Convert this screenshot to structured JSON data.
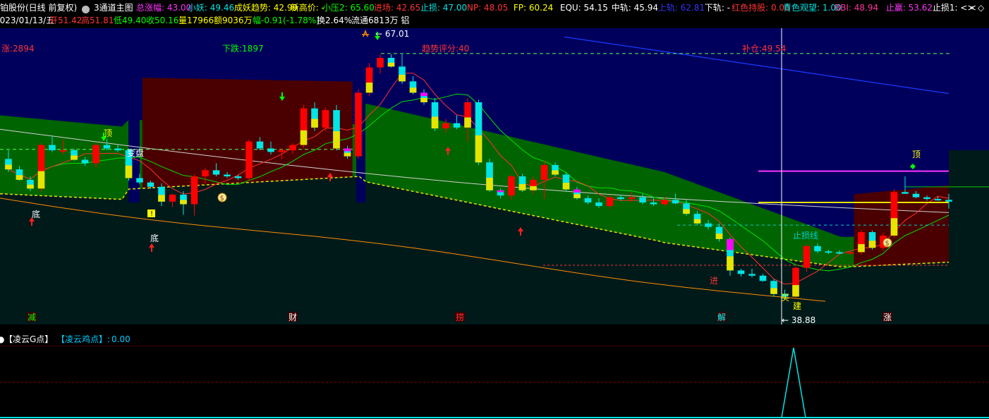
{
  "header": {
    "stock_name": "铂股份(日线 前复权)",
    "indicator": "3通道主图",
    "items": [
      {
        "label": "总涨幅:",
        "value": "43.00",
        "color": "#ff33ff"
      },
      {
        "label": "小妖:",
        "value": "49.46",
        "color": "#00e5e5"
      },
      {
        "label": "成妖趋势:",
        "value": "42.99",
        "color": "#ffff00"
      },
      {
        "label": "新高价:",
        "value": "-",
        "color": "#ffff00"
      },
      {
        "label": "小压2:",
        "value": "65.60",
        "color": "#00ff00"
      },
      {
        "label": "进场:",
        "value": "42.65",
        "color": "#ff3333"
      },
      {
        "label": "止损:",
        "value": "47.00",
        "color": "#00e5e5"
      },
      {
        "label": "NP:",
        "value": "48.05",
        "color": "#ff3333"
      },
      {
        "label": "FP:",
        "value": "60.24",
        "color": "#ffff00"
      },
      {
        "label": "EQU:",
        "value": "54.15",
        "color": "#ffffff"
      },
      {
        "label": "中轨:",
        "value": "45.94",
        "color": "#ffffff"
      },
      {
        "label": "上轨:",
        "value": "62.81",
        "color": "#3333ff"
      },
      {
        "label": "下轨:",
        "value": "-",
        "color": "#ffffff"
      },
      {
        "label": "红色持股:",
        "value": "0.00",
        "color": "#ff3333"
      },
      {
        "label": "青色观望:",
        "value": "1.00",
        "color": "#00e5e5"
      },
      {
        "label": "BBI:",
        "value": "48.94",
        "color": "#ff3399"
      },
      {
        "label": "止赢:",
        "value": "53.62",
        "color": "#ff33ff"
      },
      {
        "label": "止损1:",
        "value": "<>",
        "color": "#ffffff"
      }
    ],
    "ohlc_line": {
      "date": "2023/01/13/五",
      "open": "开51.42",
      "high": "高51.81",
      "low": "低49.40",
      "close": "收50.16",
      "volume": "量17966",
      "amount": "额9036万",
      "change": "幅-0.91(-1.78%)",
      "turnover": "换2.64%",
      "float": "流通6813万 铝"
    }
  },
  "annotations": {
    "up_count": "涨:2894",
    "down_count": "下跌:1897",
    "trend_score": "趋势评分:40",
    "fill_pos": "补仓:49.54",
    "max_price": "67.01",
    "min_price": "38.88",
    "top1": "顶",
    "top2": "顶",
    "bottom1": "底",
    "bottom2": "底",
    "change_disk": "变盘",
    "stop_loss_line": "止损线",
    "enter": "进",
    "buy": "买",
    "build": "建"
  },
  "markers": [
    "减",
    "财",
    "捞",
    "解",
    "涨"
  ],
  "sub": {
    "label1": "【凌云G点】",
    "label2": "【凌云鸡点】:",
    "value": "0.00"
  },
  "colors": {
    "background": "#000000",
    "channel_top_bg": "#00005c",
    "channel_mid_green": "#006400",
    "channel_mid_red": "#4a0000",
    "channel_bottom_bg": "#001a1a",
    "candle_red": "#ff0000",
    "candle_cyan": "#00e5e5",
    "candle_yellow": "#e5e500",
    "candle_magenta": "#ff00ff",
    "ma_red": "#ff3030",
    "ma_green": "#00e000",
    "ma_white": "#d0d0d0",
    "low_line": "#ff8c00",
    "upper_blue": "#1a3aff"
  },
  "chart_data": {
    "type": "candlestick",
    "yrange": [
      36,
      70
    ],
    "candles": [
      [
        55.0,
        56.0,
        53.5,
        53.8
      ],
      [
        53.8,
        54.2,
        52.5,
        52.6
      ],
      [
        52.6,
        53.0,
        51.3,
        51.6
      ],
      [
        51.6,
        56.8,
        51.2,
        56.6
      ],
      [
        56.6,
        57.6,
        55.8,
        56.0
      ],
      [
        56.0,
        57.2,
        55.5,
        56.0
      ],
      [
        56.0,
        56.2,
        54.8,
        54.9
      ],
      [
        54.9,
        55.2,
        54.2,
        54.5
      ],
      [
        54.5,
        56.8,
        54.0,
        56.6
      ],
      [
        56.6,
        57.3,
        56.0,
        56.2
      ],
      [
        56.2,
        56.6,
        55.8,
        56.0
      ],
      [
        56.0,
        56.2,
        52.5,
        52.8
      ],
      [
        52.8,
        53.3,
        52.1,
        52.3
      ],
      [
        52.3,
        52.5,
        51.6,
        51.8
      ],
      [
        51.8,
        52.2,
        49.6,
        50.1
      ],
      [
        50.1,
        51.0,
        49.5,
        50.9
      ],
      [
        50.9,
        51.3,
        48.6,
        49.8
      ],
      [
        49.8,
        53.2,
        48.5,
        53.0
      ],
      [
        53.0,
        54.0,
        52.2,
        53.7
      ],
      [
        53.7,
        54.5,
        53.0,
        53.2
      ],
      [
        53.2,
        53.5,
        52.8,
        53.0
      ],
      [
        53.0,
        53.2,
        52.6,
        52.8
      ],
      [
        52.8,
        57.2,
        52.5,
        57.0
      ],
      [
        57.0,
        57.5,
        56.0,
        56.2
      ],
      [
        56.2,
        57.0,
        55.5,
        55.8
      ],
      [
        55.8,
        56.2,
        55.0,
        56.0
      ],
      [
        56.0,
        56.8,
        55.6,
        56.6
      ],
      [
        56.6,
        61.2,
        56.2,
        60.8
      ],
      [
        60.8,
        61.5,
        58.2,
        58.6
      ],
      [
        58.6,
        60.9,
        58.2,
        60.6
      ],
      [
        60.6,
        61.2,
        56.0,
        56.2
      ],
      [
        56.2,
        56.5,
        55.0,
        55.3
      ],
      [
        55.3,
        63.0,
        55.0,
        62.6
      ],
      [
        62.6,
        66.0,
        62.2,
        65.5
      ],
      [
        65.5,
        67.01,
        64.8,
        66.6
      ],
      [
        66.6,
        67.0,
        65.5,
        65.6
      ],
      [
        65.6,
        67.0,
        63.6,
        63.9
      ],
      [
        63.9,
        64.5,
        62.4,
        62.6
      ],
      [
        62.6,
        63.0,
        61.2,
        61.5
      ],
      [
        61.5,
        62.0,
        58.2,
        58.5
      ],
      [
        58.5,
        59.6,
        58.0,
        59.1
      ],
      [
        59.1,
        60.0,
        58.4,
        58.6
      ],
      [
        58.6,
        62.0,
        57.0,
        61.5
      ],
      [
        61.5,
        61.8,
        54.3,
        54.6
      ],
      [
        54.6,
        55.0,
        51.2,
        51.4
      ],
      [
        51.4,
        51.6,
        50.5,
        50.8
      ],
      [
        50.8,
        53.2,
        50.3,
        53.0
      ],
      [
        53.0,
        53.3,
        51.2,
        51.4
      ],
      [
        51.4,
        53.0,
        51.0,
        52.6
      ],
      [
        52.6,
        54.8,
        50.4,
        54.3
      ],
      [
        54.3,
        54.6,
        53.0,
        53.2
      ],
      [
        53.2,
        53.5,
        51.3,
        51.5
      ],
      [
        51.5,
        51.8,
        50.3,
        50.5
      ],
      [
        50.5,
        50.8,
        49.8,
        50.0
      ],
      [
        50.0,
        50.5,
        49.4,
        49.6
      ],
      [
        49.6,
        50.9,
        49.3,
        50.6
      ],
      [
        50.6,
        50.9,
        50.2,
        50.4
      ],
      [
        50.4,
        51.2,
        50.0,
        50.6
      ],
      [
        50.6,
        51.0,
        49.8,
        50.0
      ],
      [
        50.0,
        50.5,
        49.6,
        49.8
      ],
      [
        49.8,
        50.6,
        49.6,
        50.3
      ],
      [
        50.3,
        51.0,
        49.8,
        49.9
      ],
      [
        49.9,
        50.3,
        48.5,
        48.7
      ],
      [
        48.7,
        49.0,
        47.4,
        47.6
      ],
      [
        47.6,
        48.0,
        46.9,
        47.2
      ],
      [
        47.2,
        47.6,
        45.5,
        45.8
      ],
      [
        45.8,
        46.0,
        41.6,
        42.2
      ],
      [
        42.2,
        42.4,
        41.5,
        41.8
      ],
      [
        41.8,
        42.4,
        41.4,
        41.6
      ],
      [
        41.6,
        41.8,
        40.9,
        41.0
      ],
      [
        41.0,
        41.2,
        39.2,
        39.5
      ],
      [
        39.5,
        40.0,
        38.88,
        39.2
      ],
      [
        39.2,
        42.7,
        38.9,
        42.5
      ],
      [
        42.5,
        45.2,
        42.0,
        45.0
      ],
      [
        45.0,
        45.3,
        44.2,
        44.4
      ],
      [
        44.4,
        44.6,
        44.1,
        44.3
      ],
      [
        44.3,
        44.5,
        44.1,
        44.2
      ],
      [
        44.2,
        44.4,
        44.0,
        44.3
      ],
      [
        44.3,
        46.8,
        44.0,
        46.6
      ],
      [
        46.6,
        46.8,
        44.6,
        44.8
      ],
      [
        44.8,
        46.5,
        44.5,
        46.2
      ],
      [
        46.2,
        51.5,
        46.0,
        51.2
      ],
      [
        51.2,
        53.0,
        51.0,
        51.0
      ],
      [
        51.0,
        51.3,
        50.5,
        50.6
      ],
      [
        50.6,
        50.8,
        50.2,
        50.4
      ],
      [
        50.4,
        50.7,
        50.2,
        50.3
      ],
      [
        50.3,
        51.0,
        49.3,
        50.1
      ]
    ]
  }
}
